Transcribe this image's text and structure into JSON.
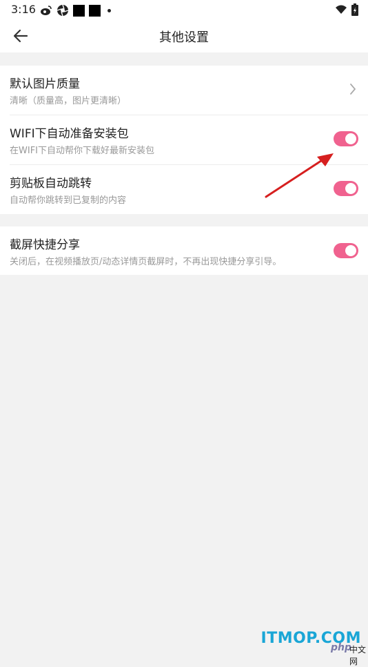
{
  "status_bar": {
    "time": "3:16"
  },
  "header": {
    "title": "其他设置"
  },
  "settings": {
    "image_quality": {
      "title": "默认图片质量",
      "subtitle": "清晰（质量高，图片更清晰）"
    },
    "wifi_auto_prepare": {
      "title": "WIFI下自动准备安装包",
      "subtitle": "在WIFI下自动帮你下载好最新安装包",
      "enabled": true
    },
    "clipboard_jump": {
      "title": "剪贴板自动跳转",
      "subtitle": "自动帮你跳转到已复制的内容",
      "enabled": true
    },
    "screenshot_share": {
      "title": "截屏快捷分享",
      "subtitle": "关闭后，在视频播放页/动态详情页截屏时，不再出现快捷分享引导。",
      "enabled": true
    }
  },
  "colors": {
    "toggle_on": "#f0628f",
    "annotation_arrow": "#d61f1f"
  },
  "watermark": {
    "php_text": "php",
    "cn_text": "中文网",
    "site": "ITMOP.COM"
  }
}
